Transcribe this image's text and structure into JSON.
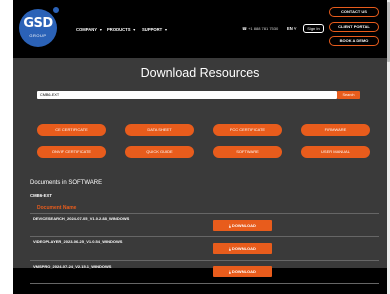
{
  "header": {
    "logo_text": "GSD",
    "logo_sub": "GROUP",
    "nav": [
      "COMPANY",
      "PRODUCTS",
      "SUPPORT"
    ],
    "phone": "☎ +1 888 781 7530",
    "lang": "EN ˅",
    "sign_in": "Sign In",
    "buttons": [
      "CONTACT US",
      "CLIENT PORTAL",
      "BOOK A DEMO"
    ]
  },
  "page_title": "Download Resources",
  "search": {
    "value": "CMB6-EXT",
    "button": "Search"
  },
  "categories": [
    "CE CERTIFICATE",
    "DATA SHEET",
    "FCC CERTIFICATE",
    "FIRMWARE",
    "ONVIF CERTIFICATE",
    "QUICK GUIDE",
    "SOFTWARE",
    "USER MANUAL"
  ],
  "documents": {
    "heading": "Documents in SOFTWARE",
    "model": "CMB6-EXT",
    "column_header": "Document Name",
    "rows": [
      {
        "name": "DEVICESEARCH_2024-07-05_V1.0.2.88_WINDOWS",
        "action": "⤓ DOWNLOAD"
      },
      {
        "name": "VIDEOPLAYER_2023-06-25_V1.0.54_WINDOWS",
        "action": "⤓ DOWNLOAD"
      },
      {
        "name": "VMSPRO_2024-07-24_V2.15.1_WINDOWS",
        "action": "⤓ DOWNLOAD"
      }
    ]
  },
  "colors": {
    "accent": "#e85c1c",
    "logo": "#2b62b7",
    "background": "#000000",
    "banner": "#3a3a3a"
  }
}
